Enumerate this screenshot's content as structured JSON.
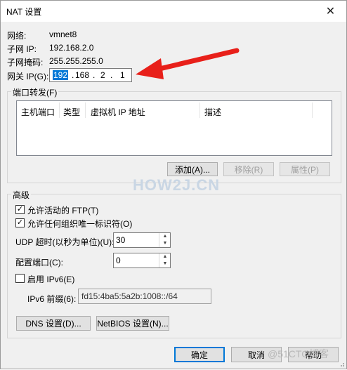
{
  "dialog": {
    "title": "NAT 设置",
    "close_glyph": "✕"
  },
  "network": {
    "label": "网络:",
    "value": "vmnet8",
    "subnet_ip_label": "子网 IP:",
    "subnet_ip": "192.168.2.0",
    "mask_label": "子网掩码:",
    "mask": "255.255.255.0",
    "gateway_label": "网关 IP(G):",
    "gateway_octets": [
      "192",
      "168",
      "2",
      "1"
    ],
    "gateway_dot": "."
  },
  "port_forwarding": {
    "title": "端口转发(F)",
    "columns": [
      "主机端口",
      "类型",
      "虚拟机 IP 地址",
      "描述"
    ],
    "add_label": "添加(A)...",
    "remove_label": "移除(R)",
    "properties_label": "属性(P)"
  },
  "advanced": {
    "title": "高级",
    "allow_ftp_label": "允许活动的 FTP(T)",
    "allow_ftp_checked": true,
    "allow_uid_label": "允许任何组织唯一标识符(O)",
    "allow_uid_checked": true,
    "udp_timeout_label": "UDP 超时(以秒为单位)(U):",
    "udp_timeout_value": "30",
    "config_port_label": "配置端口(C):",
    "config_port_value": "0",
    "enable_ipv6_label": "启用 IPv6(E)",
    "enable_ipv6_checked": false,
    "ipv6_prefix_label": "IPv6 前缀(6):",
    "ipv6_prefix_value": "fd15:4ba5:5a2b:1008::/64",
    "dns_label": "DNS 设置(D)...",
    "netbios_label": "NetBIOS 设置(N)..."
  },
  "footer": {
    "ok_label": "确定",
    "cancel_label": "取消",
    "help_label": "帮助"
  },
  "watermark": {
    "center": "HOW2J.CN",
    "corner": "@51CTO博客"
  },
  "colors": {
    "arrow": "#e8201a",
    "selection": "#0078d7",
    "accent_border": "#0078d7"
  },
  "icons": {
    "close": "close-icon",
    "check": "checkmark-icon",
    "spin": "spin-arrows-icon",
    "arrow": "red-pointer-arrow"
  }
}
